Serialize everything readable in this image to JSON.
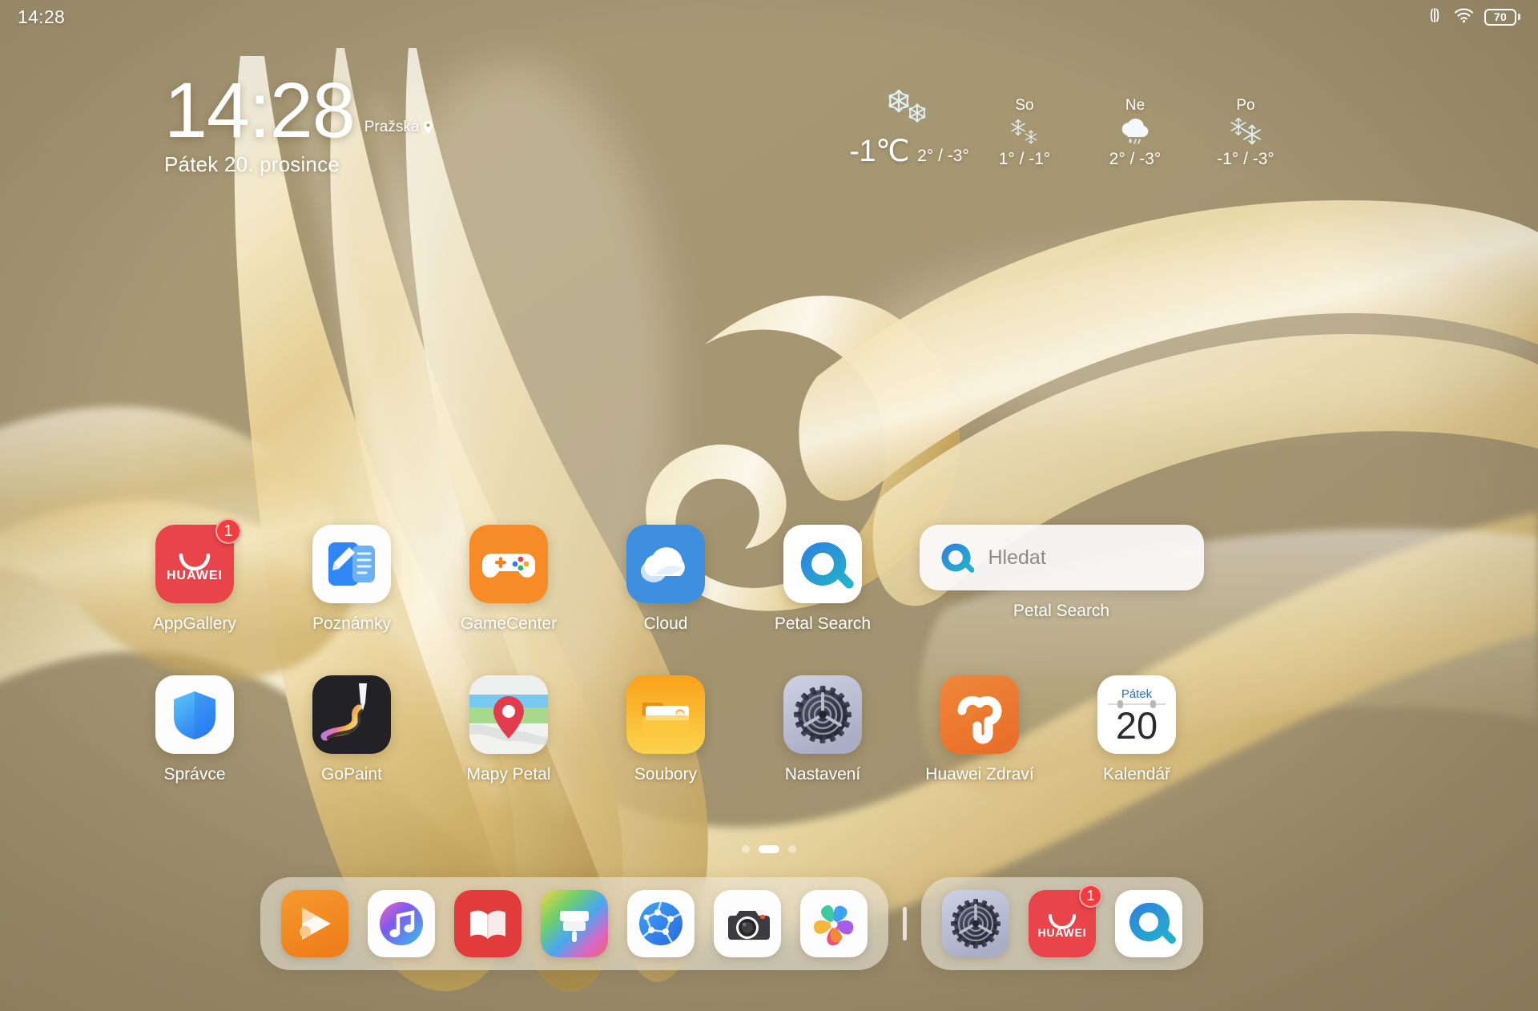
{
  "statusbar": {
    "time": "14:28",
    "battery_level": "70",
    "icons": [
      "vibrate-icon",
      "wifi-icon",
      "battery-icon"
    ]
  },
  "clock_widget": {
    "time": "14:28",
    "location": "Pražská",
    "date": "Pátek 20. prosince"
  },
  "weather": {
    "current": {
      "icon": "snow-icon",
      "temp": "-1℃",
      "range": "2° / -3°"
    },
    "forecast": [
      {
        "day": "So",
        "icon": "snow-icon",
        "range": "1° / -1°"
      },
      {
        "day": "Ne",
        "icon": "sleet-icon",
        "range": "2° / -3°"
      },
      {
        "day": "Po",
        "icon": "snow-icon",
        "range": "-1° / -3°"
      }
    ]
  },
  "home": {
    "row1": [
      {
        "label": "AppGallery",
        "icon": "appgallery-icon",
        "badge": "1"
      },
      {
        "label": "Poznámky",
        "icon": "notes-icon",
        "badge": ""
      },
      {
        "label": "GameCenter",
        "icon": "gamecenter-icon",
        "badge": ""
      },
      {
        "label": "Cloud",
        "icon": "cloud-icon",
        "badge": ""
      },
      {
        "label": "Petal Search",
        "icon": "petal-search-icon",
        "badge": ""
      }
    ],
    "row2": [
      {
        "label": "Správce",
        "icon": "optimizer-shield-icon",
        "badge": ""
      },
      {
        "label": "GoPaint",
        "icon": "gopaint-icon",
        "badge": ""
      },
      {
        "label": "Mapy Petal",
        "icon": "petal-maps-icon",
        "badge": ""
      },
      {
        "label": "Soubory",
        "icon": "files-folder-icon",
        "badge": ""
      },
      {
        "label": "Nastavení",
        "icon": "settings-gear-icon",
        "badge": ""
      },
      {
        "label": "Huawei Zdraví",
        "icon": "huawei-health-icon",
        "badge": ""
      }
    ]
  },
  "search_widget": {
    "placeholder": "Hledat",
    "label": "Petal Search",
    "icon": "petal-search-icon"
  },
  "calendar_widget": {
    "weekday": "Pátek",
    "day": "20",
    "label": "Kalendář"
  },
  "page_indicator": {
    "count": 3,
    "active_index": 1
  },
  "dock": {
    "main": [
      {
        "name": "Video",
        "icon": "video-play-icon"
      },
      {
        "name": "Hudba",
        "icon": "music-note-icon"
      },
      {
        "name": "Knihy",
        "icon": "books-icon"
      },
      {
        "name": "Motivy",
        "icon": "themes-brush-icon"
      },
      {
        "name": "Prohlížeč",
        "icon": "browser-globe-icon"
      },
      {
        "name": "Fotoaparát",
        "icon": "camera-icon"
      },
      {
        "name": "Galerie",
        "icon": "gallery-flower-icon"
      }
    ],
    "recent": [
      {
        "name": "Nastavení",
        "icon": "settings-gear-icon",
        "badge": ""
      },
      {
        "name": "AppGallery",
        "icon": "appgallery-icon",
        "badge": "1"
      },
      {
        "name": "Petal Search",
        "icon": "petal-search-icon",
        "badge": ""
      }
    ]
  },
  "colors": {
    "wallpaper_base": "#a89972",
    "badge_red": "#f03d3d",
    "appgallery_red": "#e8444a",
    "gamecenter_orange": "#f68b28",
    "cloud_blue": "#3f8fe0",
    "files_yellow": "#fbc22a",
    "health_orange": "#ec7a2e",
    "calendar_blue": "#2f6fd0"
  }
}
